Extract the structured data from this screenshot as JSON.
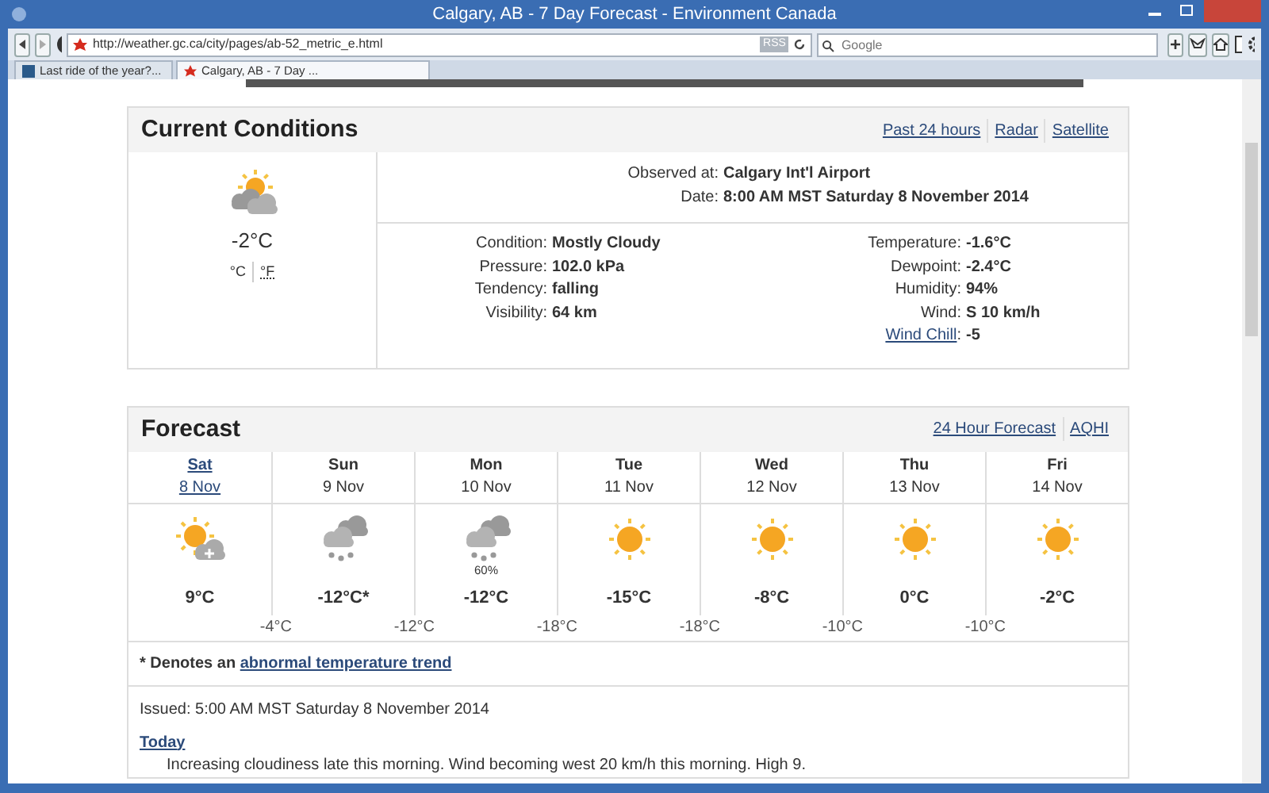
{
  "window": {
    "title": "Calgary, AB - 7 Day Forecast - Environment Canada"
  },
  "toolbar": {
    "url": "http://weather.gc.ca/city/pages/ab-52_metric_e.html",
    "rss": "RSS",
    "search_placeholder": "Google"
  },
  "tabs": [
    {
      "label": "Last ride of the year?...",
      "selected": false
    },
    {
      "label": "Calgary, AB - 7 Day ...",
      "selected": true
    }
  ],
  "current_conditions": {
    "title": "Current Conditions",
    "links": [
      "Past 24 hours",
      "Radar",
      "Satellite"
    ],
    "kind": "sun_cloud",
    "temperature": "-2°C",
    "units": [
      {
        "label": "°C",
        "selected": true
      },
      {
        "label": "°F",
        "selected": false
      }
    ],
    "observed": [
      {
        "label": "Observed at:",
        "value": "Calgary Int'l Airport"
      },
      {
        "label": "Date:",
        "value": "8:00 AM MST Saturday 8 November 2014"
      }
    ],
    "details_left": [
      {
        "label": "Condition:",
        "value": "Mostly Cloudy",
        "kind": "text"
      },
      {
        "label": "Pressure:",
        "value": "102.0 kPa",
        "kind": "text"
      },
      {
        "label": "Tendency:",
        "value": "falling",
        "kind": "text"
      },
      {
        "label": "Visibility:",
        "value": "64 km",
        "kind": "text"
      }
    ],
    "details_right": [
      {
        "label": "Temperature:",
        "value": "-1.6°C",
        "kind": "text"
      },
      {
        "label": "Dewpoint:",
        "value": "-2.4°C",
        "kind": "text"
      },
      {
        "label": "Humidity:",
        "value": "94%",
        "kind": "text"
      },
      {
        "label": "Wind:",
        "value": "S 10 km/h",
        "kind": "text"
      },
      {
        "label": "Wind Chill",
        "suffix": ":",
        "value": "-5",
        "kind": "link"
      }
    ]
  },
  "forecast": {
    "title": "Forecast",
    "links": [
      "24 Hour Forecast",
      "AQHI"
    ],
    "days": [
      {
        "day": "Sat",
        "date": "8 Nov",
        "selected": true,
        "kind": "sun_flurries",
        "high": "9°C",
        "low": "-4°C"
      },
      {
        "day": "Sun",
        "date": "9 Nov",
        "selected": false,
        "kind": "cloud_snow",
        "high": "-12°C*",
        "low": "-12°C"
      },
      {
        "day": "Mon",
        "date": "10 Nov",
        "selected": false,
        "kind": "cloud_snow",
        "pop": "60%",
        "high": "-12°C",
        "low": "-18°C"
      },
      {
        "day": "Tue",
        "date": "11 Nov",
        "selected": false,
        "kind": "sun",
        "high": "-15°C",
        "low": "-18°C"
      },
      {
        "day": "Wed",
        "date": "12 Nov",
        "selected": false,
        "kind": "sun",
        "high": "-8°C",
        "low": "-10°C"
      },
      {
        "day": "Thu",
        "date": "13 Nov",
        "selected": false,
        "kind": "sun",
        "high": "0°C",
        "low": "-10°C"
      },
      {
        "day": "Fri",
        "date": "14 Nov",
        "selected": false,
        "kind": "sun",
        "high": "-2°C"
      }
    ],
    "footnote": "* Denotes an",
    "footnote_link": "abnormal temperature trend",
    "issued": "Issued: 5:00 AM MST Saturday 8 November 2014",
    "periods": [
      {
        "title": "Today",
        "text": "Increasing cloudiness late this morning. Wind becoming west 20 km/h this morning. High 9."
      }
    ]
  }
}
